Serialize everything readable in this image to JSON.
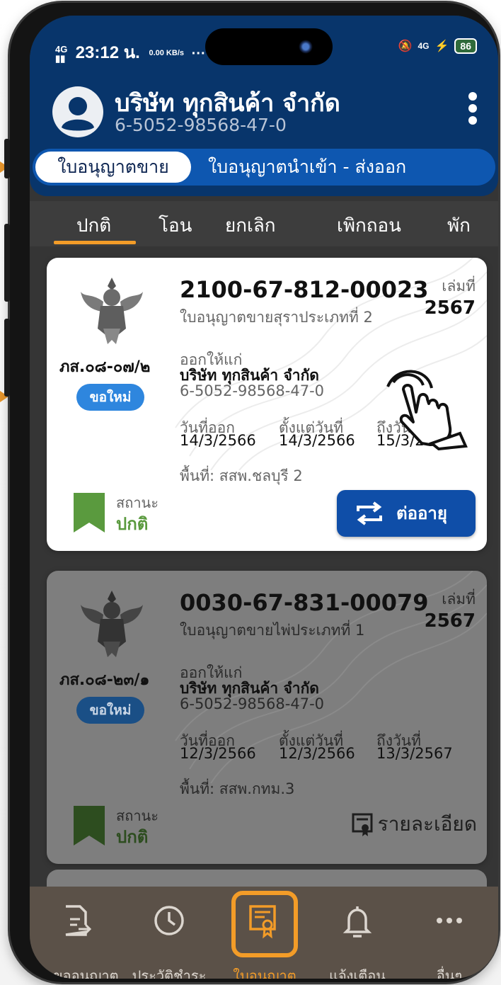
{
  "status_bar": {
    "network": "4G",
    "time": "23:12 น.",
    "speed": "0.00 KB/s",
    "more": "···",
    "net_right": "4G",
    "charging": "⚡",
    "battery": "86"
  },
  "header": {
    "company_name": "บริษัท ทุกสินค้า จำกัด",
    "company_id": "6-5052-98568-47-0"
  },
  "license_toggle": {
    "active": "ใบอนุญาตขาย",
    "inactive": "ใบอนุญาตนำเข้า - ส่งออก"
  },
  "tabs": [
    "ปกติ",
    "โอน",
    "ยกเลิก",
    "เพิกถอน",
    "พัก"
  ],
  "cards": [
    {
      "license_no": "2100-67-812-00023",
      "license_type": "ใบอนุญาตขายสุราประเภทที่ 2",
      "volume_label": "เล่มที่",
      "volume": "2567",
      "form_no": "ภส.๐๘-๐๗/๒",
      "request_badge": "ขอใหม่",
      "issued_to_label": "ออกให้แก่",
      "holder_name": "บริษัท ทุกสินค้า จำกัด",
      "holder_id": "6-5052-98568-47-0",
      "issue_label": "วันที่ออก",
      "issue_date": "14/3/2566",
      "from_label": "ตั้งแต่วันที่",
      "from_date": "14/3/2566",
      "to_label": "ถึงวันที่",
      "to_date": "15/3/2567",
      "area": "พื้นที่: สสพ.ชลบุรี 2",
      "status_label": "สถานะ",
      "status_value": "ปกติ",
      "action": "ต่ออายุ"
    },
    {
      "license_no": "0030-67-831-00079",
      "license_type": "ใบอนุญาตขายไพ่ประเภทที่ 1",
      "volume_label": "เล่มที่",
      "volume": "2567",
      "form_no": "ภส.๐๘-๒๓/๑",
      "request_badge": "ขอใหม่",
      "issued_to_label": "ออกให้แก่",
      "holder_name": "บริษัท ทุกสินค้า จำกัด",
      "holder_id": "6-5052-98568-47-0",
      "issue_label": "วันที่ออก",
      "issue_date": "12/3/2566",
      "from_label": "ตั้งแต่วันที่",
      "from_date": "12/3/2566",
      "to_label": "ถึงวันที่",
      "to_date": "13/3/2567",
      "area": "พื้นที่: สสพ.กทม.3",
      "status_label": "สถานะ",
      "status_value": "ปกติ",
      "action": "รายละเอียด"
    }
  ],
  "bottom_nav": [
    {
      "label": "คำขออนุญาต",
      "icon": "document-arrow-icon"
    },
    {
      "label": "ประวัติชำระ",
      "icon": "clock-icon"
    },
    {
      "label": "ใบอนุญาต",
      "icon": "license-icon",
      "active": true
    },
    {
      "label": "แจ้งเตือน",
      "icon": "bell-icon"
    },
    {
      "label": "อื่นๆ",
      "icon": "more-dots-icon"
    }
  ],
  "colors": {
    "header": "#08356b",
    "accent": "#f39c28",
    "primary_button": "#0f4ea8",
    "status_ok": "#5a9a3e",
    "badge": "#2e86de"
  }
}
